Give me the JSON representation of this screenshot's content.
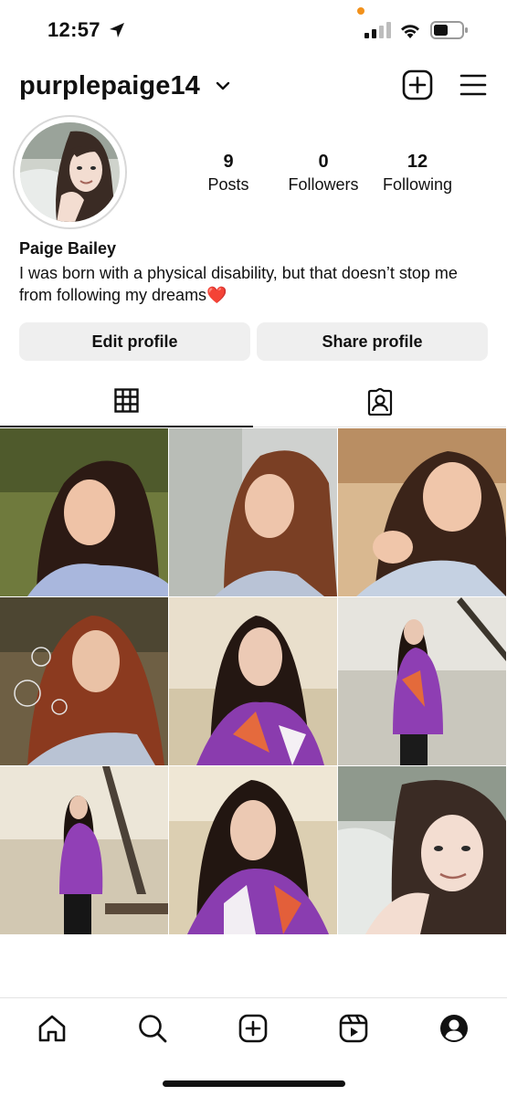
{
  "status_bar": {
    "time": "12:57",
    "icons": [
      "location-arrow-icon",
      "cellular-signal-icon",
      "wifi-icon",
      "battery-icon"
    ]
  },
  "header": {
    "username": "purplepaige14",
    "icons": [
      "chevron-down-icon",
      "new-post-icon",
      "menu-icon"
    ]
  },
  "profile": {
    "stats": [
      {
        "count": "9",
        "label": "Posts"
      },
      {
        "count": "0",
        "label": "Followers"
      },
      {
        "count": "12",
        "label": "Following"
      }
    ],
    "name": "Paige Bailey",
    "bio": "I was born with a physical disability, but that doesn’t stop me from following my dreams",
    "bio_emoji": "❤️"
  },
  "buttons": {
    "edit": "Edit profile",
    "share": "Share profile"
  },
  "tabs": [
    {
      "icon": "grid-icon",
      "selected": true
    },
    {
      "icon": "tagged-icon",
      "selected": false
    }
  ],
  "nav": {
    "icons": [
      "home-icon",
      "search-icon",
      "create-icon",
      "reels-icon",
      "profile-icon"
    ]
  },
  "colors": {
    "accent_orange": "#f2911b",
    "heart": "#e0242f",
    "button_bg": "#efefef"
  }
}
